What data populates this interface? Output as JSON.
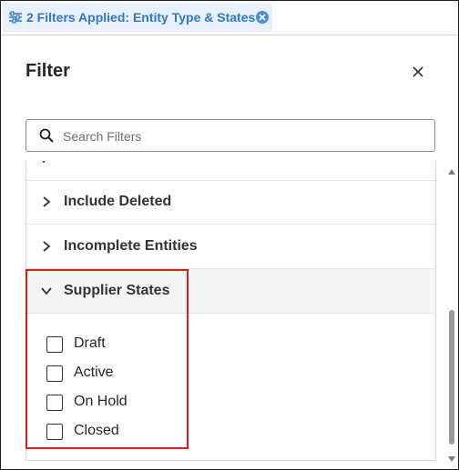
{
  "filter_chip": {
    "label": "2 Filters Applied: Entity Type & States",
    "icon": "sliders-icon",
    "clear_icon": "close-circle-icon",
    "accent_color": "#2f78c8"
  },
  "panel": {
    "title": "Filter",
    "close_icon": "close-icon"
  },
  "search": {
    "placeholder": "Search Filters",
    "value": ""
  },
  "sections": [
    {
      "label": "Include Deleted",
      "expanded": false
    },
    {
      "label": "Incomplete Entities",
      "expanded": false
    },
    {
      "label": "Supplier States",
      "expanded": true
    }
  ],
  "supplier_states": {
    "options": [
      {
        "label": "Draft",
        "checked": false
      },
      {
        "label": "Active",
        "checked": false
      },
      {
        "label": "On Hold",
        "checked": false
      },
      {
        "label": "Closed",
        "checked": false
      }
    ]
  },
  "highlight_color": "#e01b1b"
}
